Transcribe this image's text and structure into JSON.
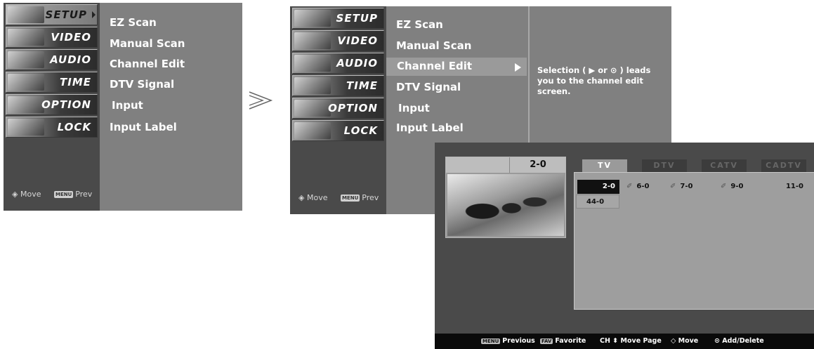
{
  "categories": [
    {
      "label": "SETUP"
    },
    {
      "label": "VIDEO"
    },
    {
      "label": "AUDIO"
    },
    {
      "label": "TIME"
    },
    {
      "label": "OPTION"
    },
    {
      "label": "LOCK"
    }
  ],
  "footer": {
    "move": "Move",
    "move_badge": "◈",
    "prev": "Prev",
    "prev_badge": "MENU"
  },
  "menu_items": [
    "EZ Scan",
    "Manual Scan",
    "Channel Edit",
    "DTV Signal",
    "Input",
    "Input Label"
  ],
  "description": "Selection ( ▶ or ⊙ ) leads you to the channel edit screen.",
  "channel_edit": {
    "preview_channel": "2-0",
    "tabs": [
      "TV",
      "DTV",
      "CATV",
      "CADTV"
    ],
    "selected_tab": "TV",
    "channels": [
      {
        "num": "2-0",
        "selected": true,
        "favorite": false
      },
      {
        "num": "6-0",
        "selected": false,
        "favorite": true
      },
      {
        "num": "7-0",
        "selected": false,
        "favorite": true
      },
      {
        "num": "9-0",
        "selected": false,
        "favorite": true
      },
      {
        "num": "11-0",
        "selected": false,
        "favorite": false
      },
      {
        "num": "44-0",
        "selected": false,
        "favorite": false
      }
    ],
    "footer": [
      {
        "badge": "MENU",
        "label": "Previous"
      },
      {
        "badge": "FAV",
        "label": "Favorite"
      },
      {
        "badge": "CH ⬍",
        "label": "Move Page"
      },
      {
        "badge": "◇",
        "label": "Move"
      },
      {
        "badge": "⊙",
        "label": "Add/Delete"
      }
    ]
  },
  "colors": {
    "panel": "#808080",
    "category_bg": "#4a4a4a",
    "highlight": "#9a9a9a"
  }
}
